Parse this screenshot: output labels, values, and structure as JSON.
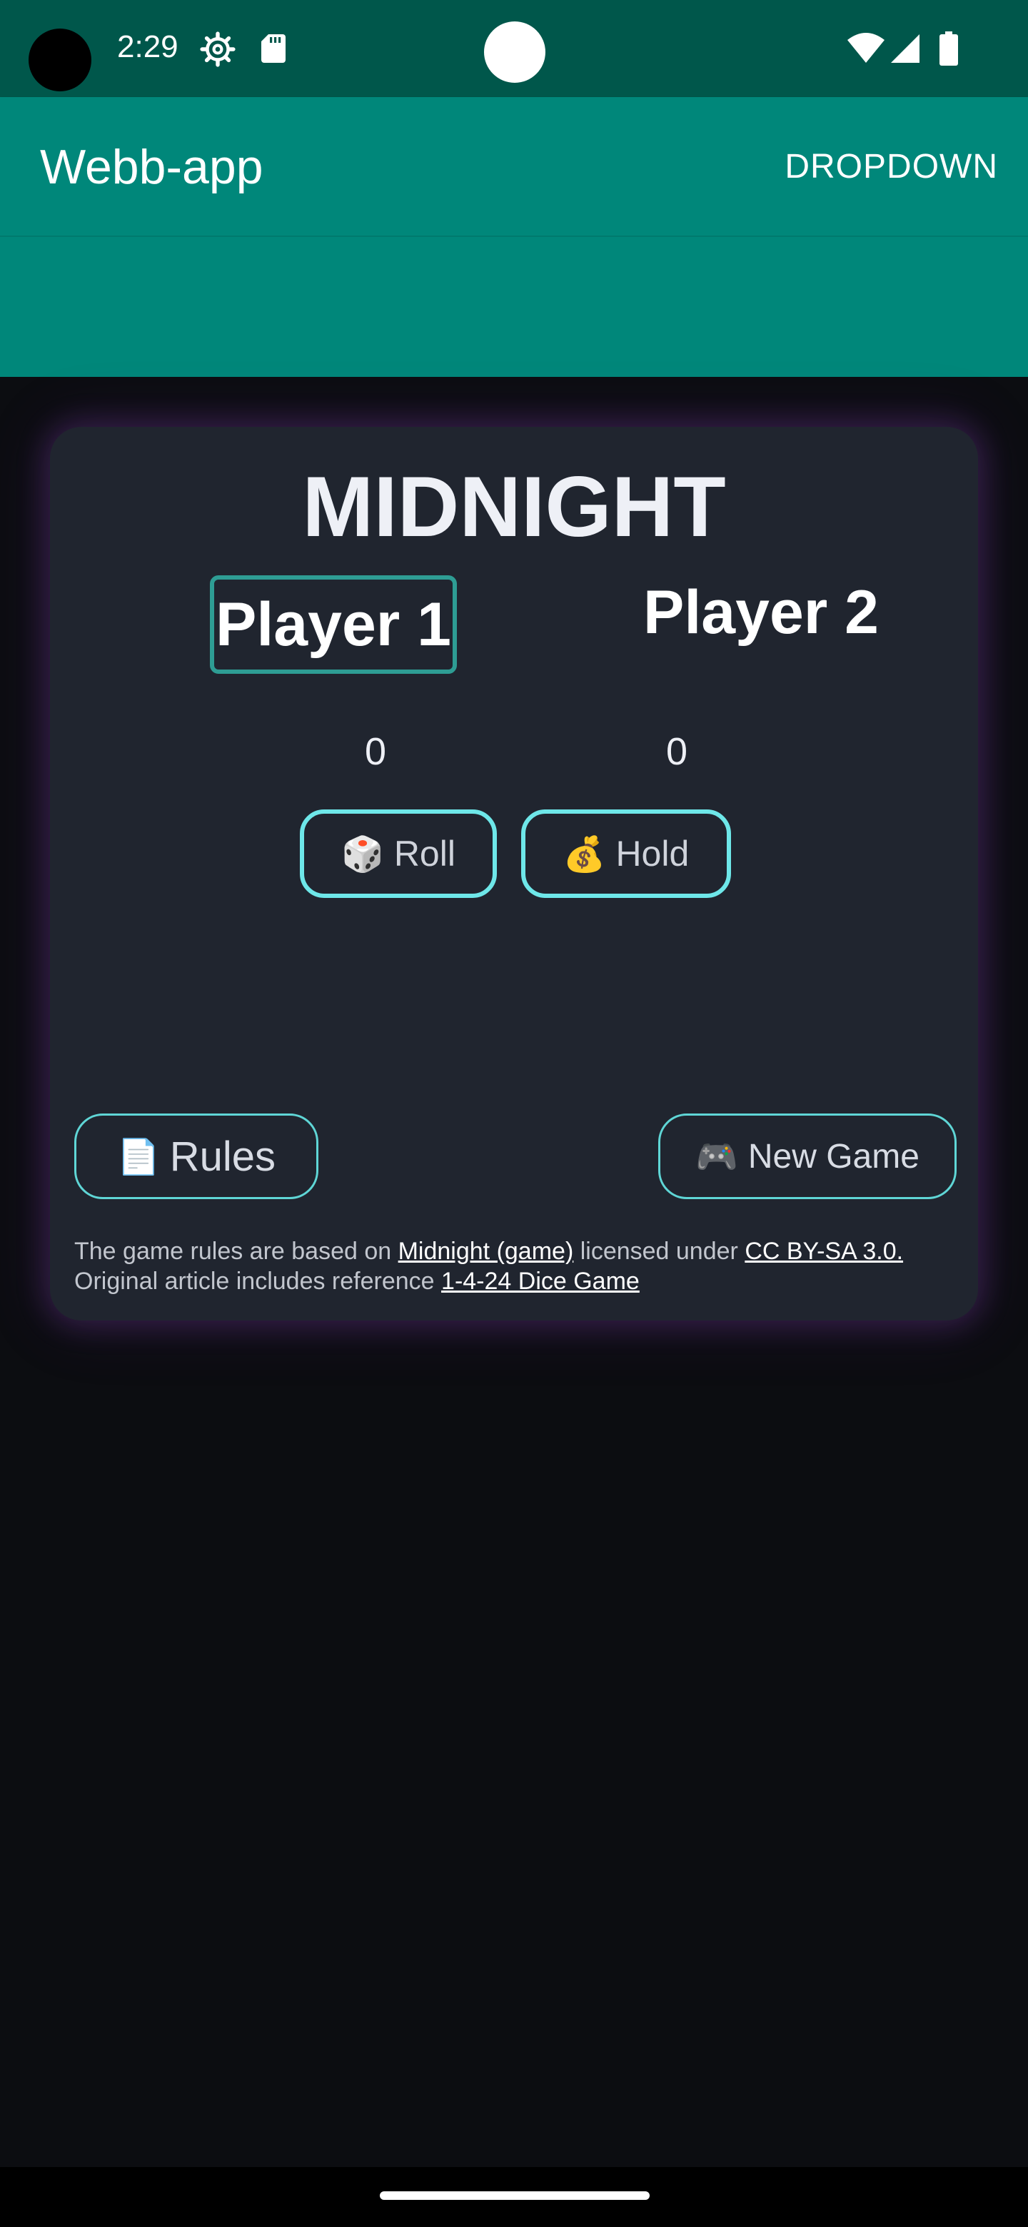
{
  "status_bar": {
    "time": "2:29",
    "icons": [
      "settings-gear-icon",
      "sd-card-icon",
      "wifi-icon",
      "cell-signal-icon",
      "battery-icon"
    ]
  },
  "app_bar": {
    "title": "Webb-app",
    "menu_label": "DROPDOWN"
  },
  "game": {
    "title": "MIDNIGHT",
    "players": [
      {
        "name": "Player 1",
        "score": "0",
        "active": true
      },
      {
        "name": "Player 2",
        "score": "0",
        "active": false
      }
    ],
    "roll": {
      "icon": "🎲",
      "label": "Roll"
    },
    "hold": {
      "icon": "💰",
      "label": "Hold"
    },
    "rules": {
      "icon": "📄",
      "label": "Rules"
    },
    "new_game": {
      "icon": "🎮",
      "label": "New Game"
    }
  },
  "attribution": {
    "text_1": "The game rules are based on ",
    "link_1": "Midnight (game)",
    "text_2": " licensed under ",
    "link_2": "CC BY-SA 3.0.",
    "text_3": "Original article includes reference ",
    "link_3": "1-4-24 Dice Game"
  },
  "colors": {
    "status_bar": "#00574b",
    "app_bar": "#00877a",
    "background": "#0c0d11",
    "card": "#20252f",
    "active_border": "#2e9d94",
    "button_border": "#6ee7e9"
  }
}
